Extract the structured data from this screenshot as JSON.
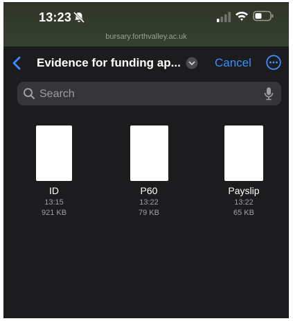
{
  "status_bar": {
    "time": "13:23",
    "icons": [
      "bell-slash-icon",
      "signal-icon",
      "wifi-icon",
      "battery-icon"
    ],
    "url": "bursary.forthvalley.ac.uk"
  },
  "nav": {
    "back_icon": "chevron-left-icon",
    "title": "Evidence for funding ap...",
    "title_menu_icon": "chevron-down-circle-icon",
    "cancel_label": "Cancel",
    "more_icon": "ellipsis-circle-icon"
  },
  "search": {
    "placeholder": "Search",
    "value": ""
  },
  "files": [
    {
      "name": "ID",
      "time": "13:15",
      "size": "921 KB"
    },
    {
      "name": "P60",
      "time": "13:22",
      "size": "79 KB"
    },
    {
      "name": "Payslip",
      "time": "13:22",
      "size": "65 KB"
    }
  ],
  "colors": {
    "background": "#1c1c1e",
    "accent": "#3a8eff",
    "status_bar": "#313b2c",
    "search_field": "#36363a"
  }
}
